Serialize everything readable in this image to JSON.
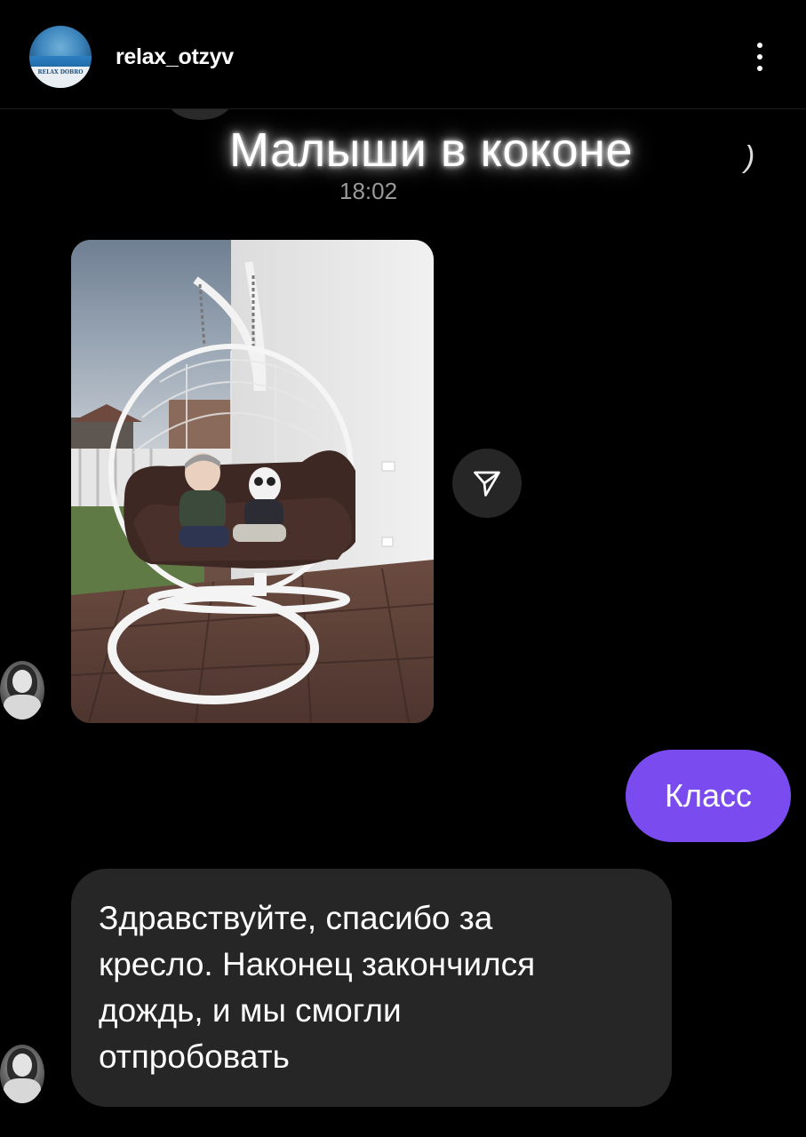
{
  "header": {
    "username": "relax_otzyv",
    "avatar_logo_text": "RELAX DOBRO",
    "menu_icon": "more-vertical-icon"
  },
  "sticker": {
    "text": "Малыши в коконе",
    "time": "18:02"
  },
  "photo": {
    "description_icon": "photo-message"
  },
  "forward_icon": "send-paper-plane-icon",
  "messages": {
    "outgoing_text": "Класс",
    "incoming_text": "Здравствуйте, спасибо за\nкресло. Наконец закончился\nдождь, и мы смогли\nотпробовать"
  },
  "colors": {
    "outgoing_bubble": "#7a4cef",
    "incoming_bubble": "#262626",
    "background": "#000000"
  }
}
